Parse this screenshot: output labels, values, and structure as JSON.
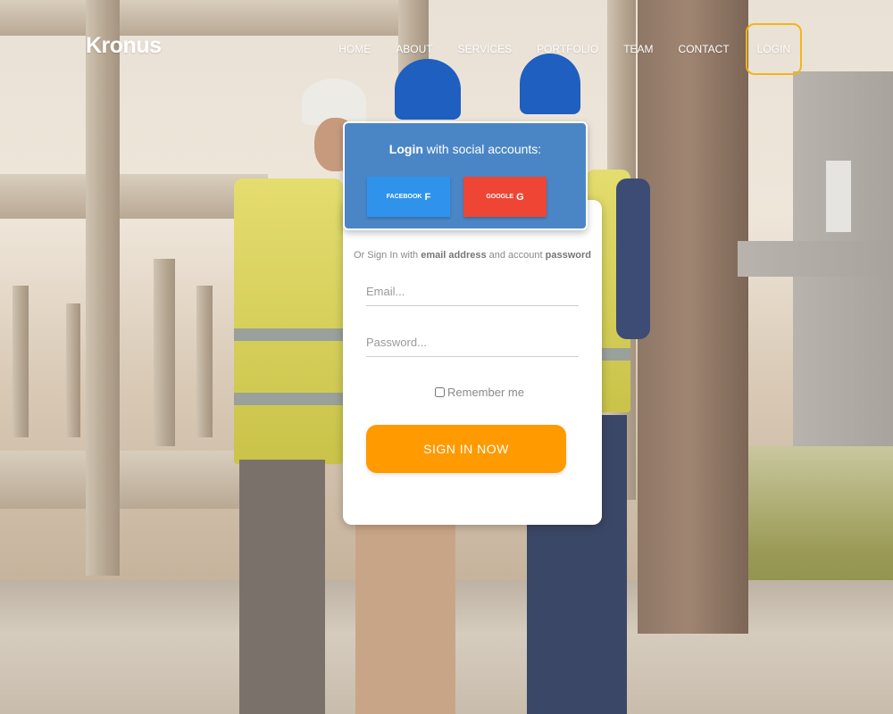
{
  "brand": {
    "name": "Kronus"
  },
  "nav": {
    "items": [
      {
        "label": "HOME"
      },
      {
        "label": "ABOUT"
      },
      {
        "label": "SERVICES"
      },
      {
        "label": "PORTFOLIO"
      },
      {
        "label": "TEAM"
      },
      {
        "label": "CONTACT"
      }
    ],
    "login": "LOGIN"
  },
  "social": {
    "title_bold": "Login",
    "title_rest": " with social accounts:",
    "facebook": {
      "label": "FACEBOOK",
      "icon": "f",
      "color": "#2f93ec"
    },
    "google": {
      "label": "GOOGLE",
      "icon": "G",
      "color": "#ef4535"
    }
  },
  "form": {
    "hint": {
      "part1": "Or Sign In with ",
      "bold1": "email address",
      "part2": " and account ",
      "bold2": "password"
    },
    "email_placeholder": "Email...",
    "password_placeholder": "Password...",
    "remember_label": "Remember me",
    "submit_label": "SIGN IN NOW"
  },
  "colors": {
    "accent": "#ff9a00",
    "login_outline": "#f2b51a",
    "social_panel": "#4a86c6"
  }
}
